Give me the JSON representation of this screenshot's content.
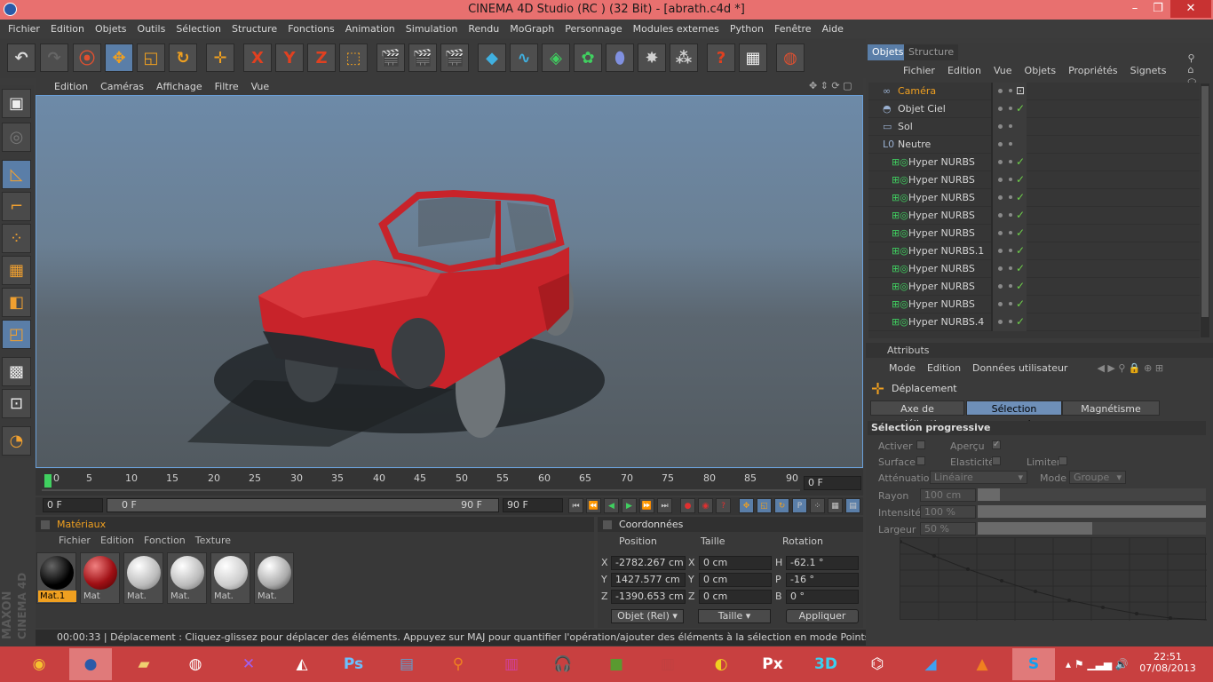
{
  "window": {
    "title": "CINEMA 4D Studio (RC ) (32 Bit) - [abrath.c4d *]",
    "minimize": "–",
    "maximize": "❐",
    "close": "✕"
  },
  "menu": [
    "Fichier",
    "Edition",
    "Objets",
    "Outils",
    "Sélection",
    "Structure",
    "Fonctions",
    "Animation",
    "Simulation",
    "Rendu",
    "MoGraph",
    "Personnage",
    "Modules externes",
    "Python",
    "Fenêtre",
    "Aide"
  ],
  "toolbar": {
    "axes": [
      "X",
      "Y",
      "Z"
    ]
  },
  "viewport": {
    "menu": [
      "Edition",
      "Caméras",
      "Affichage",
      "Filtre",
      "Vue"
    ]
  },
  "timeline": {
    "ticks": [
      "0",
      "5",
      "10",
      "15",
      "20",
      "25",
      "30",
      "35",
      "40",
      "45",
      "50",
      "55",
      "60",
      "65",
      "70",
      "75",
      "80",
      "85",
      "90"
    ],
    "current_frame": "0 F",
    "start": "0 F",
    "range_start": "0 F",
    "range_end": "90 F",
    "end": "90 F"
  },
  "materials": {
    "title": "Matériaux",
    "menu": [
      "Fichier",
      "Edition",
      "Fonction",
      "Texture"
    ],
    "items": [
      {
        "label": "Mat.1",
        "color": "#1a1a1a"
      },
      {
        "label": "Mat",
        "color": "#b0151a"
      },
      {
        "label": "Mat.",
        "color": "#d8d8d8"
      },
      {
        "label": "Mat.",
        "color": "#d8d8d8"
      },
      {
        "label": "Mat.",
        "color": "#d8d8d8"
      },
      {
        "label": "Mat.",
        "color": "#d8d8d8"
      }
    ]
  },
  "coords": {
    "title": "Coordonnées",
    "headers": [
      "Position",
      "Taille",
      "Rotation"
    ],
    "rows": [
      {
        "axis": "X",
        "pos": "-2782.267 cm",
        "saxis": "X",
        "size": "0 cm",
        "raxis": "H",
        "rot": "-62.1 °"
      },
      {
        "axis": "Y",
        "pos": "1427.577 cm",
        "saxis": "Y",
        "size": "0 cm",
        "raxis": "P",
        "rot": "-16 °"
      },
      {
        "axis": "Z",
        "pos": "-1390.653 cm",
        "saxis": "Z",
        "size": "0 cm",
        "raxis": "B",
        "rot": "0 °"
      }
    ],
    "mode": "Objet (Rel)",
    "size_mode": "Taille",
    "apply": "Appliquer"
  },
  "status": {
    "time": "00:00:33",
    "text": "Déplacement : Cliquez-glissez pour déplacer des éléments. Appuyez sur MAJ pour quantifier l'opération/ajouter des éléments à la sélection en mode Points et sur CTRL pour en suppri"
  },
  "objects": {
    "tabs": [
      "Objets",
      "Structure"
    ],
    "menu": [
      "Fichier",
      "Edition",
      "Vue",
      "Objets",
      "Propriétés",
      "Signets"
    ],
    "items": [
      {
        "name": "Caméra",
        "indent": 0
      },
      {
        "name": "Objet Ciel",
        "indent": 0
      },
      {
        "name": "Sol",
        "indent": 0
      },
      {
        "name": "Neutre",
        "indent": 0
      },
      {
        "name": "Hyper NURBS",
        "indent": 1
      },
      {
        "name": "Hyper NURBS",
        "indent": 1
      },
      {
        "name": "Hyper NURBS",
        "indent": 1
      },
      {
        "name": "Hyper NURBS",
        "indent": 1
      },
      {
        "name": "Hyper NURBS",
        "indent": 1
      },
      {
        "name": "Hyper NURBS.1",
        "indent": 1
      },
      {
        "name": "Hyper NURBS",
        "indent": 1
      },
      {
        "name": "Hyper NURBS",
        "indent": 1
      },
      {
        "name": "Hyper NURBS",
        "indent": 1
      },
      {
        "name": "Hyper NURBS.4",
        "indent": 1
      }
    ]
  },
  "attributes": {
    "title": "Attributs",
    "menu": [
      "Mode",
      "Edition",
      "Données utilisateur"
    ],
    "tool": "Déplacement",
    "tabs": [
      "Axe de modélisation",
      "Sélection progressive",
      "Magnétisme"
    ],
    "section": "Sélection progressive",
    "labels": {
      "activer": "Activer",
      "apercu": "Aperçu",
      "surface": "Surface",
      "elasticite": "Elasticité",
      "limiter": "Limiter",
      "attenuation": "Atténuation",
      "attenuation_val": "Linéaire",
      "mode": "Mode",
      "mode_val": "Groupe",
      "rayon": "Rayon",
      "rayon_val": "100 cm",
      "intensite": "Intensité",
      "intensite_val": "100 %",
      "largeur": "Largeur",
      "largeur_val": "50 %"
    }
  },
  "clock": {
    "time": "22:51",
    "date": "07/08/2013"
  }
}
